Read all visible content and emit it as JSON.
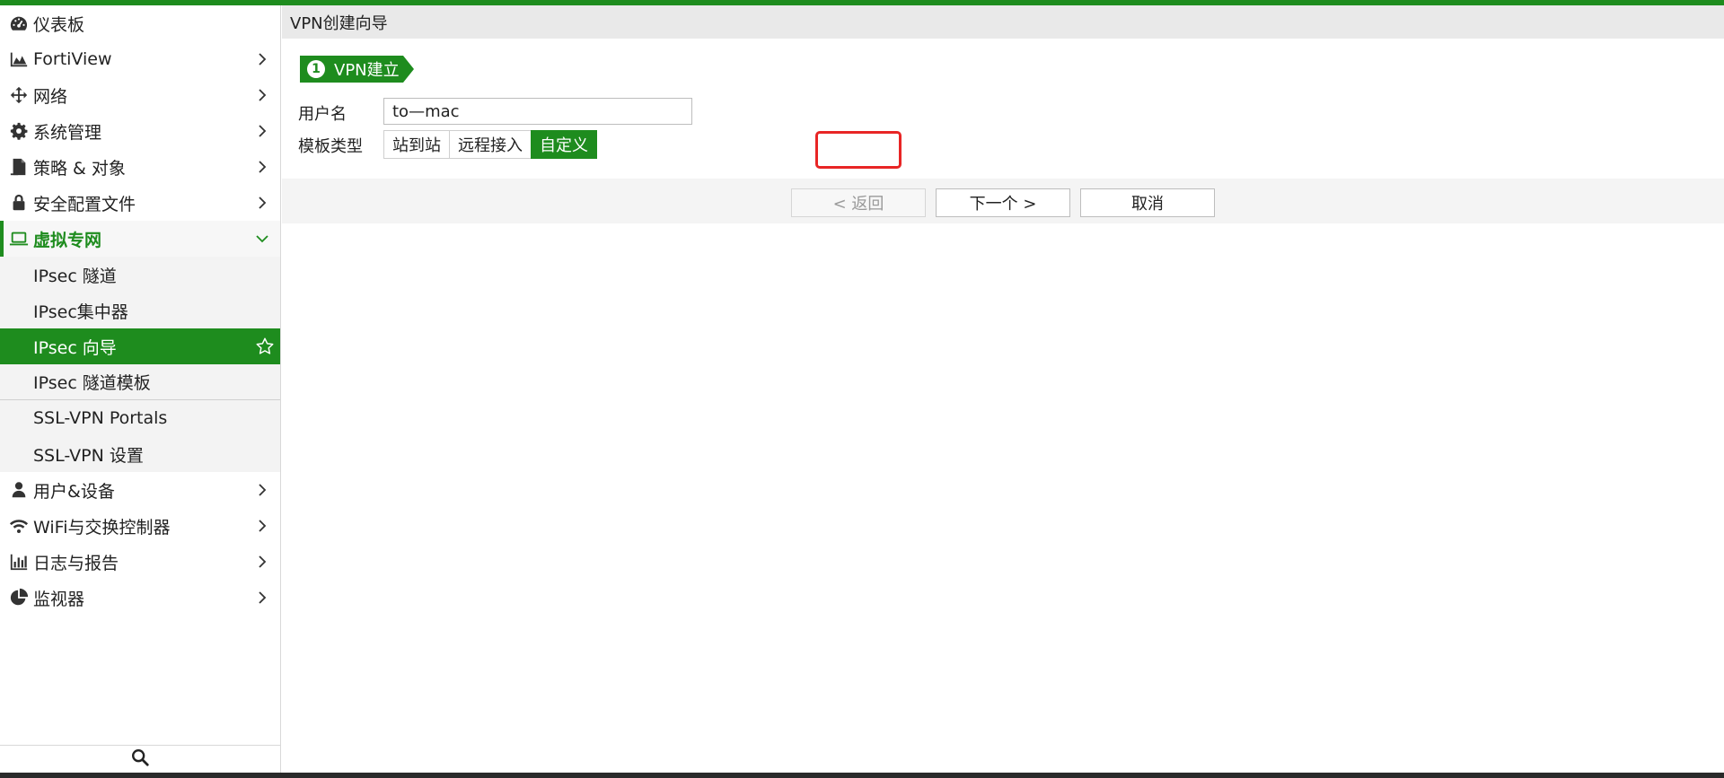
{
  "colors": {
    "brand": "#1e8c1e",
    "highlight": "#e82525",
    "header_bg": "#e9e9e9"
  },
  "sidebar": {
    "items": [
      {
        "label": "仪表板",
        "icon": "dashboard-icon",
        "chevron": false
      },
      {
        "label": "FortiView",
        "icon": "chart-area-icon",
        "chevron": true
      },
      {
        "label": "网络",
        "icon": "move-arrows-icon",
        "chevron": true
      },
      {
        "label": "系统管理",
        "icon": "gear-icon",
        "chevron": true
      },
      {
        "label": "策略 & 对象",
        "icon": "document-icon",
        "chevron": true
      },
      {
        "label": "安全配置文件",
        "icon": "lock-icon",
        "chevron": true
      },
      {
        "label": "虚拟专网",
        "icon": "laptop-icon",
        "chevron": "expanded"
      }
    ],
    "vpn_sub": [
      {
        "label": "IPsec 隧道"
      },
      {
        "label": "IPsec集中器"
      },
      {
        "label": "IPsec 向导",
        "selected": true
      },
      {
        "label": "IPsec 隧道模板"
      },
      {
        "label": "SSL-VPN Portals"
      },
      {
        "label": "SSL-VPN 设置"
      }
    ],
    "items_after": [
      {
        "label": "用户&设备",
        "icon": "user-icon",
        "chevron": true
      },
      {
        "label": "WiFi与交换控制器",
        "icon": "wifi-icon",
        "chevron": true
      },
      {
        "label": "日志与报告",
        "icon": "bar-chart-icon",
        "chevron": true
      },
      {
        "label": "监视器",
        "icon": "pie-chart-icon",
        "chevron": true
      }
    ]
  },
  "header": {
    "title": "VPN创建向导"
  },
  "step": {
    "number": "1",
    "label": "VPN建立"
  },
  "form": {
    "name_label": "用户名",
    "name_value": "to—mac",
    "template_label": "模板类型",
    "template_options": [
      "站到站",
      "远程接入",
      "自定义"
    ],
    "template_selected": "自定义"
  },
  "buttons": {
    "back": "< 返回",
    "next": "下一个 >",
    "cancel": "取消"
  }
}
